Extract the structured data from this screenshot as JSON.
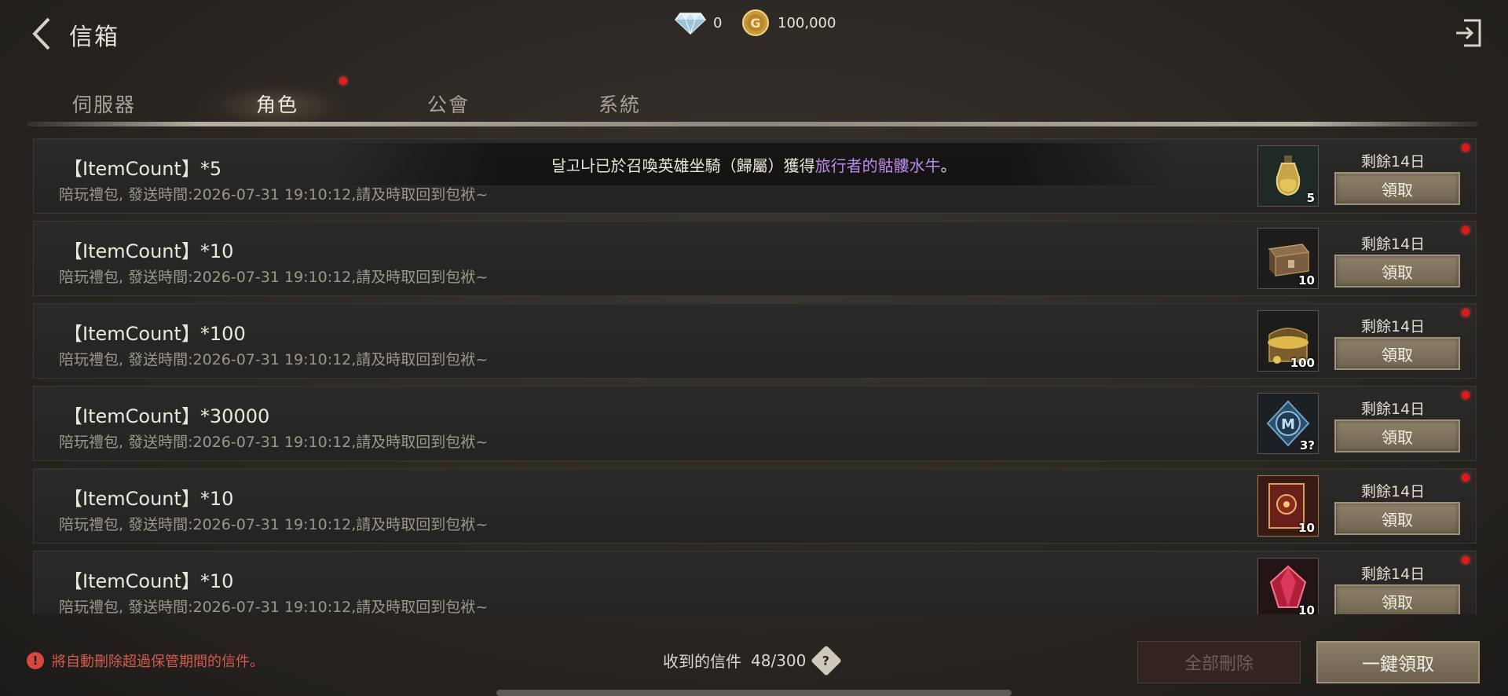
{
  "header": {
    "title": "信箱",
    "diamond_count": "0",
    "gold_count": "100,000"
  },
  "tabs": [
    {
      "label": "伺服器",
      "active": false
    },
    {
      "label": "角色",
      "active": true,
      "has_unread_dot": true
    },
    {
      "label": "公會",
      "active": false
    },
    {
      "label": "系統",
      "active": false
    }
  ],
  "toast": {
    "prefix": "달고나已於召喚英雄坐騎（歸屬）獲得",
    "highlight": "旅行者的骷髏水牛",
    "suffix": "。",
    "highlight_color": "#b98be8"
  },
  "mails": [
    {
      "title": "【ItemCount】*5",
      "desc": "陪玩禮包, 發送時間:2026-07-31 19:10:12,請及時取回到包袱~",
      "item_icon": "elixir-bottle-icon",
      "count": "5",
      "remain": "剩餘14日",
      "claim_label": "領取",
      "unread": true
    },
    {
      "title": "【ItemCount】*10",
      "desc": "陪玩禮包, 發送時間:2026-07-31 19:10:12,請及時取回到包袱~",
      "item_icon": "wooden-chest-icon",
      "count": "10",
      "remain": "剩餘14日",
      "claim_label": "領取",
      "unread": true
    },
    {
      "title": "【ItemCount】*100",
      "desc": "陪玩禮包, 發送時間:2026-07-31 19:10:12,請及時取回到包袱~",
      "item_icon": "gold-treasure-icon",
      "count": "100",
      "remain": "剩餘14日",
      "claim_label": "領取",
      "unread": true
    },
    {
      "title": "【ItemCount】*30000",
      "desc": "陪玩禮包, 發送時間:2026-07-31 19:10:12,請及時取回到包袱~",
      "item_icon": "m-coin-icon",
      "count": "3?",
      "remain": "剩餘14日",
      "claim_label": "領取",
      "unread": true
    },
    {
      "title": "【ItemCount】*10",
      "desc": "陪玩禮包, 發送時間:2026-07-31 19:10:12,請及時取回到包袱~",
      "item_icon": "red-card-pack-icon",
      "count": "10",
      "remain": "剩餘14日",
      "claim_label": "領取",
      "unread": true
    },
    {
      "title": "【ItemCount】*10",
      "desc": "陪玩禮包, 發送時間:2026-07-31 19:10:12,請及時取回到包袱~",
      "item_icon": "red-gem-icon",
      "count": "10",
      "remain": "剩餘14日",
      "claim_label": "領取",
      "unread": true
    }
  ],
  "footer": {
    "warning": "將自動刪除超過保管期間的信件。",
    "received_label": "收到的信件",
    "received_count": "48/300",
    "delete_all_label": "全部刪除",
    "claim_all_label": "一鍵領取"
  },
  "colors": {
    "unread_dot": "#e01818",
    "warning_text": "#d65a4e",
    "claim_button": "#7d735e"
  }
}
